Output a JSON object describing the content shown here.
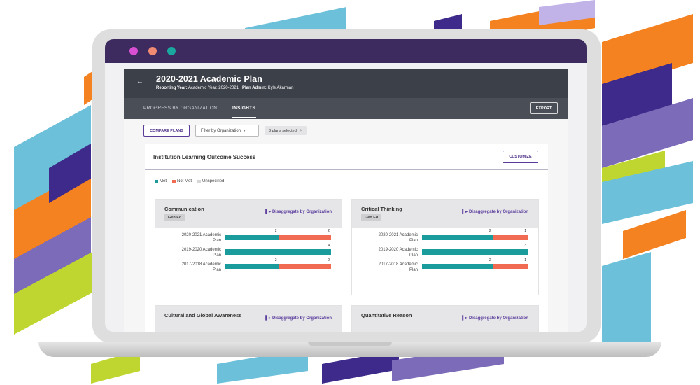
{
  "window": {
    "dots": [
      "#d94fd4",
      "#f08a73",
      "#1aa7a0"
    ],
    "titlebar_color": "#3d2a5e"
  },
  "header": {
    "back_icon": "arrow-left-icon",
    "title": "2020-2021 Academic Plan",
    "reporting_year_label": "Reporting Year:",
    "reporting_year_value": "Academic Year: 2020-2021",
    "plan_admin_label": "Plan Admin:",
    "plan_admin_value": "Kyle Akarman"
  },
  "tabs": [
    {
      "label": "PROGRESS BY ORGANIZATION",
      "active": false
    },
    {
      "label": "INSIGHTS",
      "active": true
    }
  ],
  "export_label": "EXPORT",
  "filters": {
    "compare_label": "COMPARE PLANS",
    "filter_select": "Filter by Organization",
    "chip_label": "3 plans selected",
    "chip_close_icon": "close-icon"
  },
  "panel": {
    "title": "Institution Learning Outcome Success",
    "customize_label": "CUSTOMIZE",
    "legend": [
      {
        "label": "Met",
        "color": "#1a9c9c"
      },
      {
        "label": "Not Met",
        "color": "#f16a52"
      },
      {
        "label": "Unspecified",
        "color": "#d6d6d6"
      }
    ]
  },
  "cards": [
    {
      "title": "Communication",
      "tag": "Gen Ed",
      "disaggregate_label": "Disaggregate by Organization",
      "rows": [
        {
          "label_1": "2020-2021 Academic",
          "label_2": "Plan",
          "met": 2,
          "not_met": 2
        },
        {
          "label_1": "2019-2020 Academic",
          "label_2": "Plan",
          "met": 4,
          "not_met": 0
        },
        {
          "label_1": "2017-2018 Academic",
          "label_2": "Plan",
          "met": 2,
          "not_met": 2
        }
      ]
    },
    {
      "title": "Critical Thinking",
      "tag": "Gen Ed",
      "disaggregate_label": "Disaggregate by Organization",
      "rows": [
        {
          "label_1": "2020-2021 Academic",
          "label_2": "Plan",
          "met": 2,
          "not_met": 1
        },
        {
          "label_1": "2019-2020 Academic",
          "label_2": "Plan",
          "met": 3,
          "not_met": 0
        },
        {
          "label_1": "2017-2018 Academic",
          "label_2": "Plan",
          "met": 2,
          "not_met": 1
        }
      ]
    },
    {
      "title": "Cultural and Global Awareness",
      "disaggregate_label": "Disaggregate by Organization"
    },
    {
      "title": "Quantitative Reason",
      "disaggregate_label": "Disaggregate by Organization"
    }
  ]
}
